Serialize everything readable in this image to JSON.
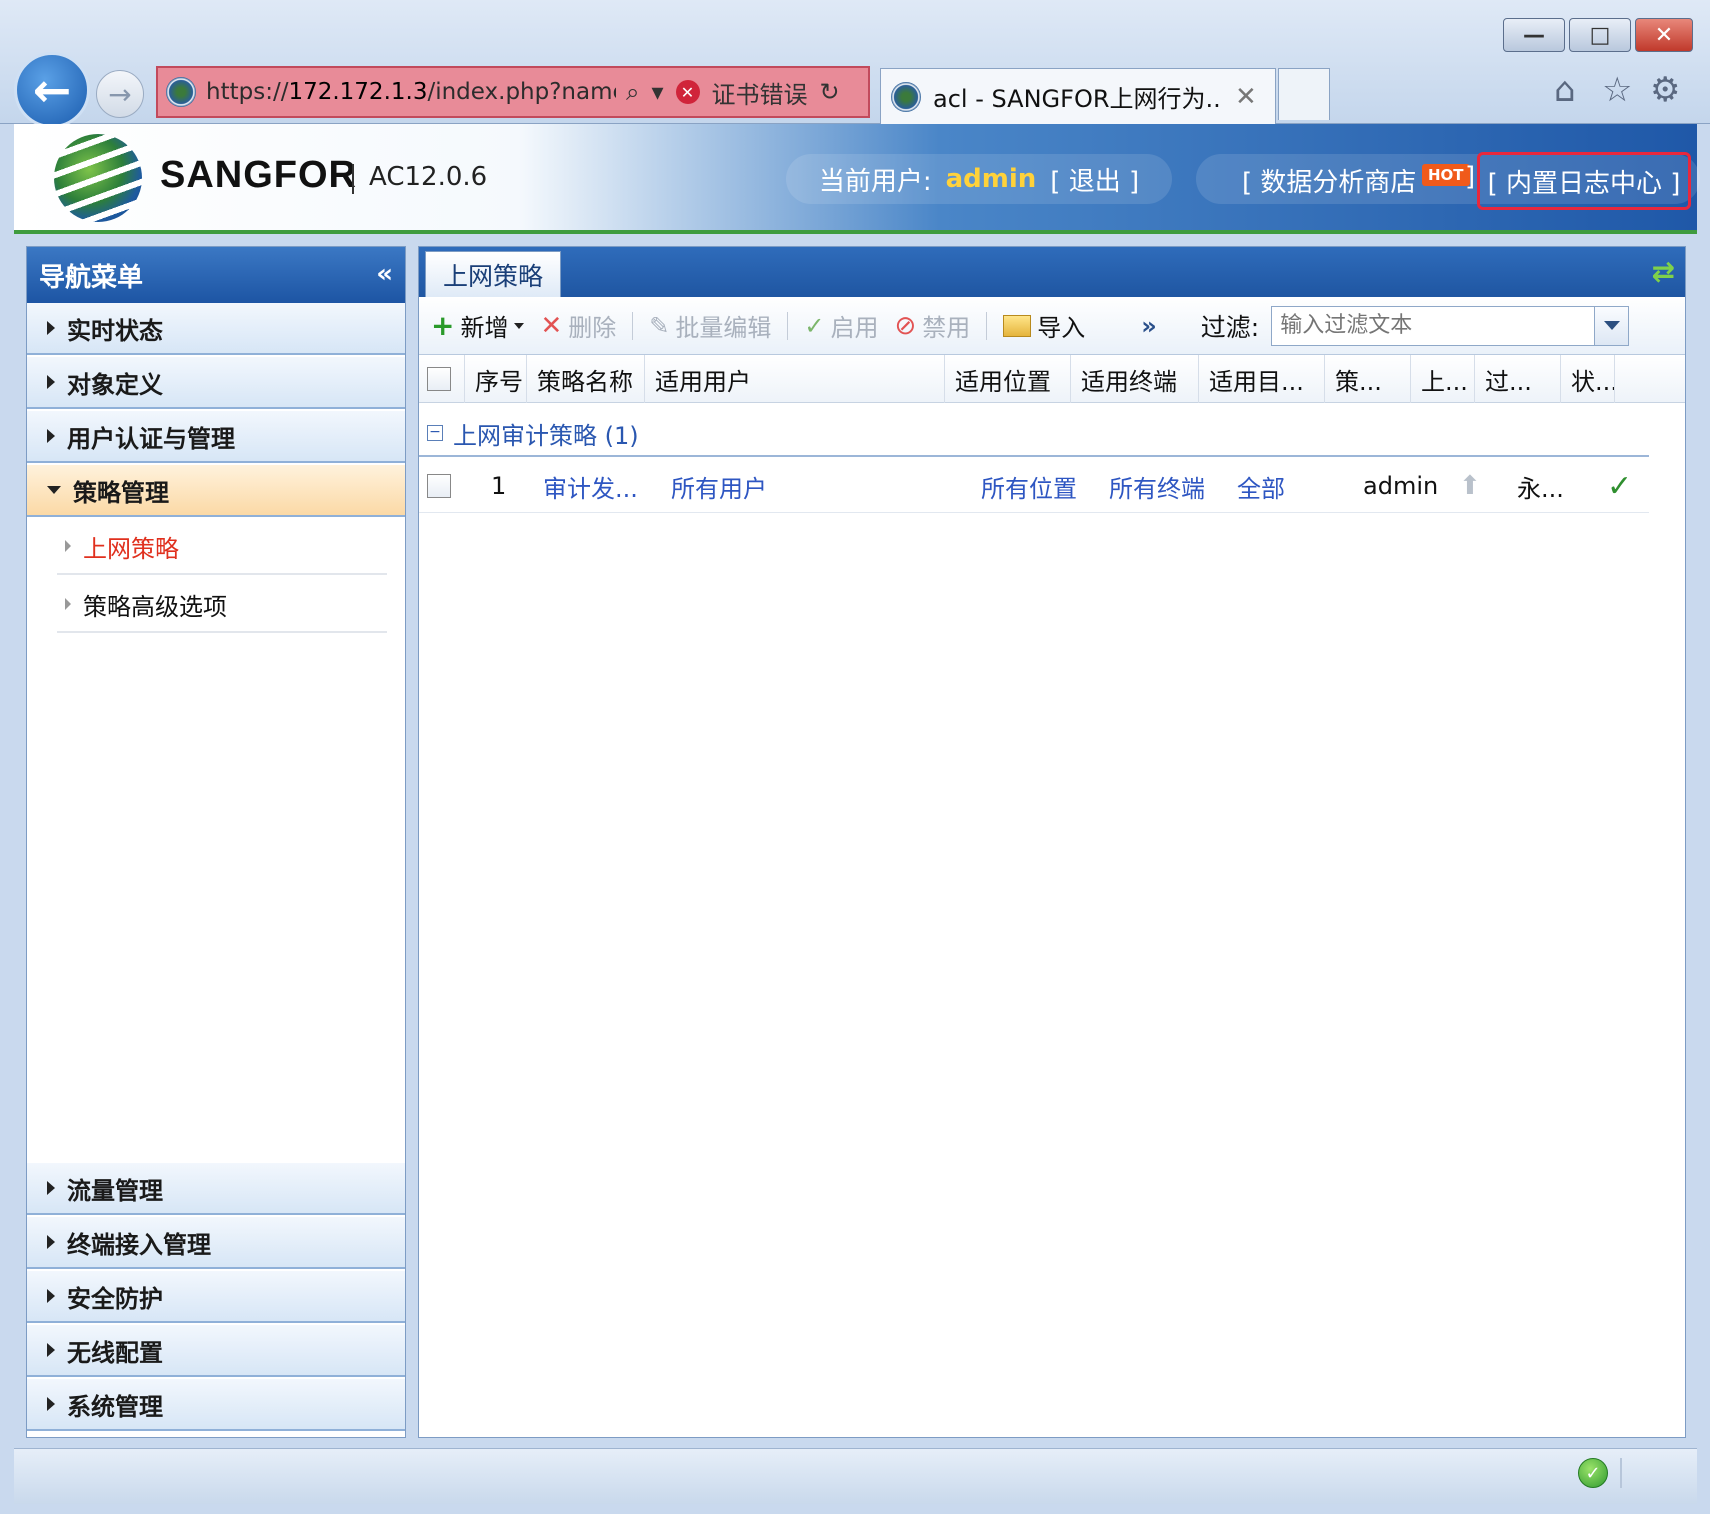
{
  "browser": {
    "address": {
      "url_prefix": "https://",
      "url_host": "172.172.1.3",
      "url_path": "/index.php?name",
      "cert_error": "证书错误"
    },
    "tab_title": "acl - SANGFOR上网行为...",
    "window_buttons": {
      "minimize": "—",
      "maximize": "□",
      "close": "✕"
    }
  },
  "header": {
    "brand": "SANGFOR",
    "version": "AC12.0.6",
    "current_user_label": "当前用户:",
    "current_user": "admin",
    "logout": "[ 退出 ]",
    "data_store": "[ 数据分析商店",
    "hot_badge": "HOT",
    "bracket_close": "]",
    "log_center": "[ 内置日志中心 ]"
  },
  "sidebar": {
    "title": "导航菜单",
    "collapse_glyph": "«",
    "groups_top": [
      {
        "label": "实时状态"
      },
      {
        "label": "对象定义"
      },
      {
        "label": "用户认证与管理"
      }
    ],
    "active_group": {
      "label": "策略管理"
    },
    "sub_items": [
      {
        "label": "上网策略",
        "active": true
      },
      {
        "label": "策略高级选项",
        "active": false
      }
    ],
    "groups_bottom": [
      {
        "label": "流量管理"
      },
      {
        "label": "终端接入管理"
      },
      {
        "label": "安全防护"
      },
      {
        "label": "无线配置"
      },
      {
        "label": "系统管理"
      }
    ]
  },
  "main": {
    "tab": "上网策略",
    "toolbar": {
      "add": "新增",
      "delete": "删除",
      "batch_edit": "批量编辑",
      "enable": "启用",
      "disable": "禁用",
      "import": "导入",
      "more": "»",
      "filter_label": "过滤:",
      "filter_placeholder": "输入过滤文本"
    },
    "columns": [
      "序号",
      "策略名称",
      "适用用户",
      "适用位置",
      "适用终端",
      "适用目...",
      "策...",
      "上...",
      "过...",
      "状..."
    ],
    "group": {
      "label": "上网审计策略 (1)"
    },
    "rows": [
      {
        "index": "1",
        "name": "审计发...",
        "users": "所有用户",
        "location": "所有位置",
        "terminal": "所有终端",
        "target": "全部",
        "creator": "admin",
        "expire": "永...",
        "status": "enabled"
      }
    ]
  },
  "colors": {
    "accent_blue": "#1f56a2",
    "highlight_red": "#e8283d",
    "active_nav": "#e0301e",
    "link_blue": "#2e56c2"
  }
}
